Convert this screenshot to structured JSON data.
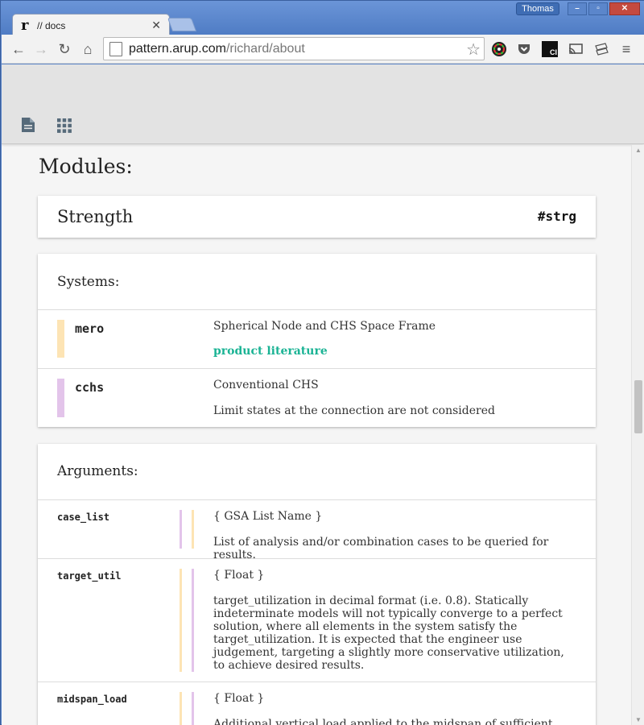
{
  "browser": {
    "tab": {
      "favicon": "r",
      "title": "// docs"
    },
    "profile": "Thomas",
    "url": {
      "host": "pattern.arup.com",
      "path": "/richard/about"
    },
    "icons": [
      "back-icon",
      "forward-icon",
      "reload-icon",
      "home-icon",
      "page-icon",
      "star-icon",
      "colorwheel-extension-icon",
      "pocket-icon",
      "ci-extension-icon",
      "cast-icon",
      "tools-extension-icon",
      "menu-icon"
    ],
    "ci_label": "CI"
  },
  "header": {
    "icons": [
      "document-icon",
      "grid-icon"
    ]
  },
  "modules_heading": "Modules:",
  "module": {
    "title": "Strength",
    "tag": "#strg"
  },
  "systems": {
    "heading": "Systems:",
    "items": [
      {
        "name": "mero",
        "description": "Spherical Node and CHS Space Frame",
        "link": "product literature",
        "color": "#fde4b4"
      },
      {
        "name": "cchs",
        "description": "Conventional CHS",
        "note": "Limit states at the connection are not considered",
        "color": "#e3c4ea"
      }
    ]
  },
  "arguments": {
    "heading": "Arguments:",
    "items": [
      {
        "name": "case_list",
        "type": "{ GSA List Name }",
        "description": "List of analysis and/or combination cases to be queried for results."
      },
      {
        "name": "target_util",
        "type": "{ Float }",
        "description": "target_utilization in decimal format (i.e. 0.8). Statically indeterminate models will not typically converge to a perfect solution, where all elements in the system satisfy the target_utilization. It is expected that the engineer use judgement, targeting a slightly more conservative utilization, to achieve desired results."
      },
      {
        "name": "midspan_load",
        "type": "{ Float }",
        "description": "Additional vertical load applied to the midspan of sufficient..."
      }
    ]
  },
  "colors": {
    "accent_link": "#1ab394",
    "mero_bar": "#fde4b4",
    "cchs_bar": "#e3c4ea",
    "chrome_blue": "#5a84c8"
  }
}
